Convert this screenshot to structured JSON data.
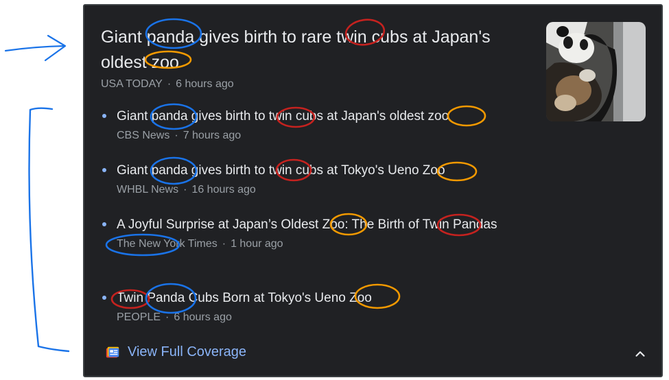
{
  "main_story": {
    "title": "Giant panda gives birth to rare twin cubs at Japan's oldest zoo",
    "source": "USA TODAY",
    "time": "6 hours ago"
  },
  "related": [
    {
      "title": "Giant panda gives birth to twin cubs at Japan's oldest zoo",
      "source": "CBS News",
      "time": "7 hours ago"
    },
    {
      "title": "Giant panda gives birth to twin cubs at Tokyo's Ueno Zoo",
      "source": "WHBL News",
      "time": "16 hours ago"
    },
    {
      "title": "A Joyful Surprise at Japan’s Oldest Zoo: The Birth of Twin Pandas",
      "source": "The New York Times",
      "time": "1 hour ago"
    },
    {
      "title": "Twin Panda Cubs Born at Tokyo's Ueno Zoo",
      "source": "PEOPLE",
      "time": "6 hours ago"
    }
  ],
  "footer": {
    "coverage_label": "View Full Coverage"
  },
  "icons": {
    "coverage": "newspaper-icon",
    "collapse": "chevron-up-icon"
  },
  "colors": {
    "card_bg": "#202124",
    "headline": "#e8eaed",
    "meta": "#9aa0a6",
    "link": "#8ab4f8",
    "annotation_blue": "#1a73e8",
    "annotation_red": "#c5221f",
    "annotation_orange": "#f29900"
  }
}
